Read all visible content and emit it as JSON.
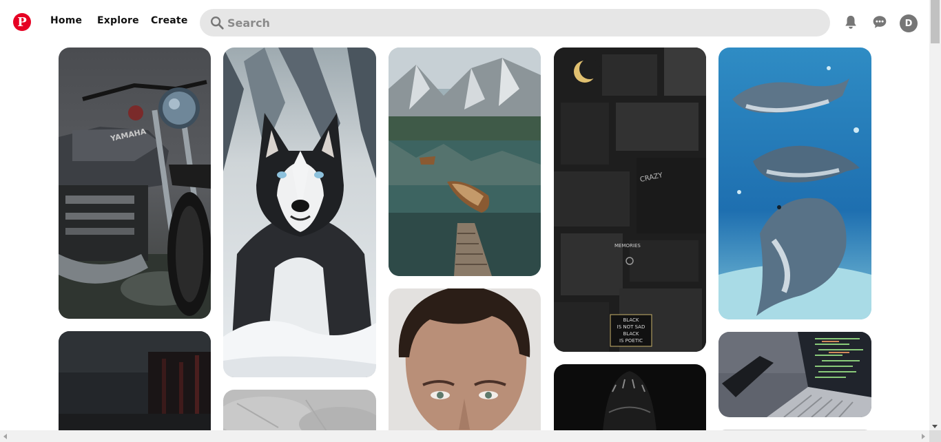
{
  "header": {
    "logo_letter": "P",
    "nav": {
      "home": "Home",
      "explore": "Explore",
      "create": "Create"
    },
    "search": {
      "placeholder": "Search",
      "value": ""
    },
    "icons": [
      "bell-icon",
      "chat-icon"
    ],
    "avatar_initial": "D"
  },
  "pins": [
    {
      "id": "motorcycle",
      "subject": "Yamaha motorcycle",
      "caption_text": [
        "YAMAHA"
      ]
    },
    {
      "id": "dark-street",
      "subject": "dark city street"
    },
    {
      "id": "husky",
      "subject": "husky in snow"
    },
    {
      "id": "grey-texture",
      "subject": "grey clouds"
    },
    {
      "id": "lake",
      "subject": "mountain lake with boat"
    },
    {
      "id": "portrait",
      "subject": "man portrait"
    },
    {
      "id": "collage",
      "subject": "dark aesthetic collage",
      "caption_text": [
        "CRAZY",
        "MEMORIES",
        "BLACK",
        "IS NOT SAD",
        "BLACK",
        "IS POETIC"
      ]
    },
    {
      "id": "dark-shape",
      "subject": "dark abstract"
    },
    {
      "id": "dolphins",
      "subject": "dolphins underwater"
    },
    {
      "id": "laptop",
      "subject": "laptop with code"
    },
    {
      "id": "partial-bottom",
      "subject": "partially visible pin"
    }
  ],
  "colors": {
    "brand": "#e60023",
    "search_bg": "#e6e6e6",
    "text": "#111111",
    "avatar_bg": "#767676"
  }
}
